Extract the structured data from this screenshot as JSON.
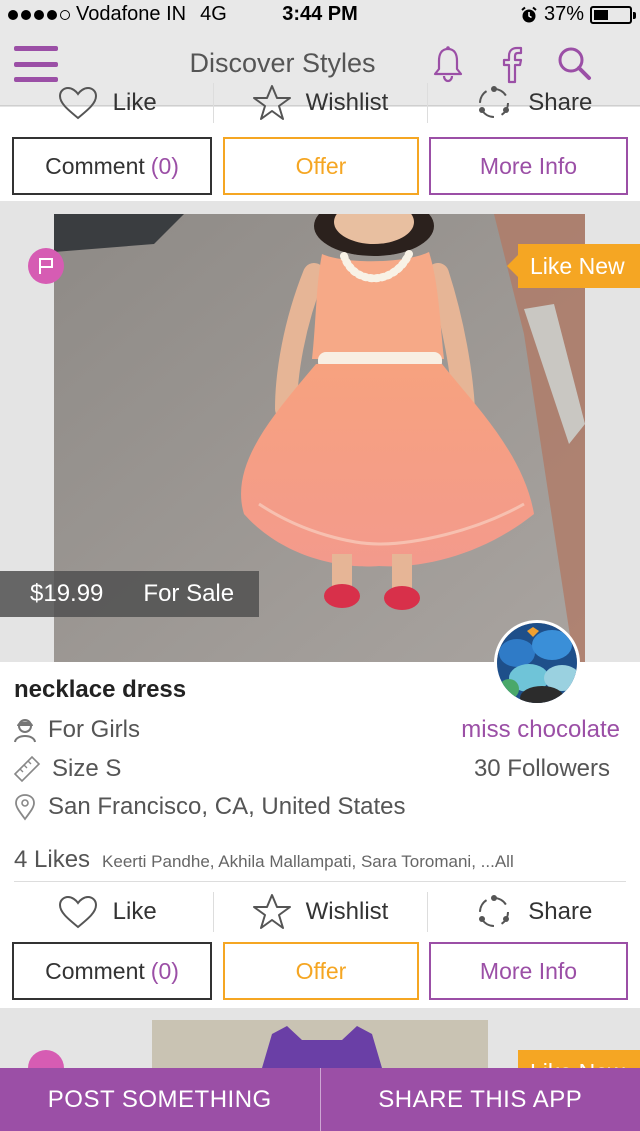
{
  "status_bar": {
    "carrier": "Vodafone IN",
    "network": "4G",
    "time": "3:44 PM",
    "battery": "37%",
    "signal_bars": 4,
    "battery_level": 0.37
  },
  "header": {
    "title": "Discover Styles",
    "icons": [
      "menu-icon",
      "bell-icon",
      "facebook-icon",
      "search-icon"
    ],
    "accent_color": "#9b4fa6"
  },
  "previous_card": {
    "actions": {
      "like": "Like",
      "wishlist": "Wishlist",
      "share": "Share"
    },
    "buttons": {
      "comment": "Comment",
      "comment_count": "(0)",
      "offer": "Offer",
      "more_info": "More Info"
    }
  },
  "listing": {
    "condition": "Like New",
    "price": "$19.99",
    "sale_type": "For Sale",
    "title": "necklace dress",
    "category": "For Girls",
    "size": "Size S",
    "location": "San Francisco, CA, United States",
    "seller_name": "miss chocolate",
    "followers": "30 Followers",
    "likes_count": "4 Likes",
    "likers": "Keerti Pandhe, Akhila Mallampati, Sara Toromani, ...All",
    "actions": {
      "like": "Like",
      "wishlist": "Wishlist",
      "share": "Share"
    },
    "buttons": {
      "comment": "Comment",
      "comment_count": "(0)",
      "offer": "Offer",
      "more_info": "More Info"
    }
  },
  "next_card": {
    "condition": "Like New"
  },
  "bottom_bar": {
    "post": "POST SOMETHING",
    "share_app": "SHARE THIS APP"
  },
  "colors": {
    "brand_purple": "#9b4fa6",
    "offer_orange": "#f5a623",
    "flag_pink": "#d65cb3"
  }
}
